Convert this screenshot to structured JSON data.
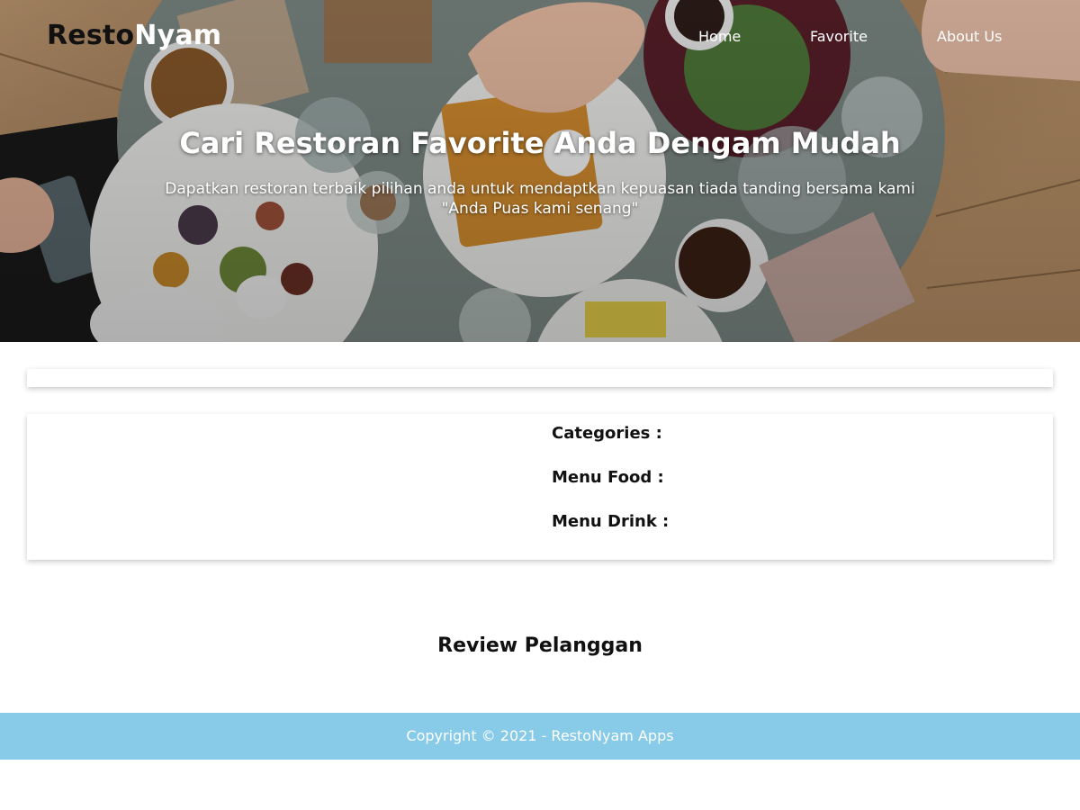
{
  "brand": {
    "part1": "Resto",
    "part2": "Nyam"
  },
  "nav": [
    {
      "label": "Home"
    },
    {
      "label": "Favorite"
    },
    {
      "label": "About Us"
    }
  ],
  "hero": {
    "title": "Cari Restoran Favorite Anda Dengam Mudah",
    "subtitle_line1": "Dapatkan restoran terbaik pilihan anda untuk mendaptkan kepuasan tiada tanding bersama kami",
    "subtitle_line2": "\"Anda Puas kami senang\""
  },
  "detail": {
    "categories_label": "Categories :",
    "menu_food_label": "Menu Food :",
    "menu_drink_label": "Menu Drink :"
  },
  "reviews": {
    "title": "Review Pelanggan"
  },
  "footer": {
    "copyright": "Copyright © 2021 - RestoNyam Apps"
  },
  "colors": {
    "footer_bg": "#87cbe8",
    "text_dark": "#111111",
    "white": "#ffffff"
  }
}
